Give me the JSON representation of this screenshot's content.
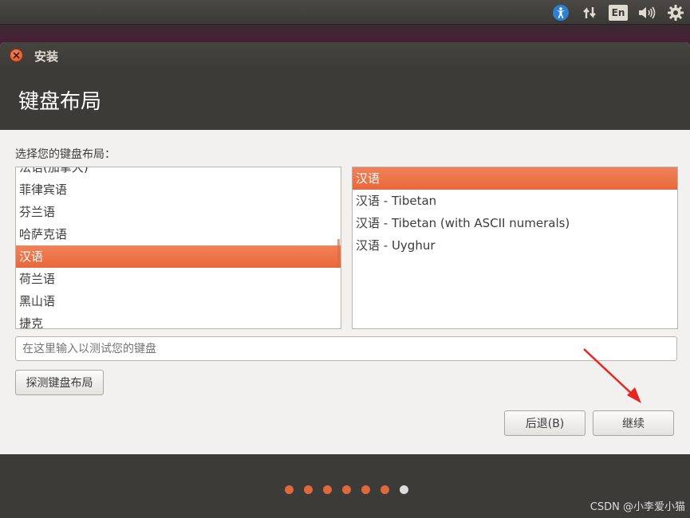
{
  "window": {
    "title": "安装"
  },
  "page": {
    "title": "键盘布局",
    "prompt": "选择您的键盘布局："
  },
  "layouts": {
    "items": [
      "法语(加拿大)",
      "菲律宾语",
      "芬兰语",
      "哈萨克语",
      "汉语",
      "荷兰语",
      "黑山语",
      "捷克"
    ],
    "selected": "汉语"
  },
  "variants": {
    "items": [
      "汉语",
      "汉语 - Tibetan",
      "汉语 - Tibetan (with ASCII numerals)",
      "汉语 - Uyghur"
    ],
    "selected": "汉语"
  },
  "test_input": {
    "placeholder": "在这里输入以测试您的键盘",
    "value": ""
  },
  "buttons": {
    "detect": "探测键盘布局",
    "back": "后退(B)",
    "continue": "继续"
  },
  "tray": {
    "input_method": "En",
    "icons": [
      "accessibility-icon",
      "network-transfer-icon",
      "keyboard-language-indicator",
      "volume-icon",
      "gear-icon"
    ]
  },
  "progress": {
    "total_steps": 7,
    "current_step": 7
  },
  "watermark": "CSDN @小李爱小猫",
  "colors": {
    "accent": "#e9673a",
    "dark_panel": "#3c3b37",
    "window_bg": "#f2f1f0"
  }
}
